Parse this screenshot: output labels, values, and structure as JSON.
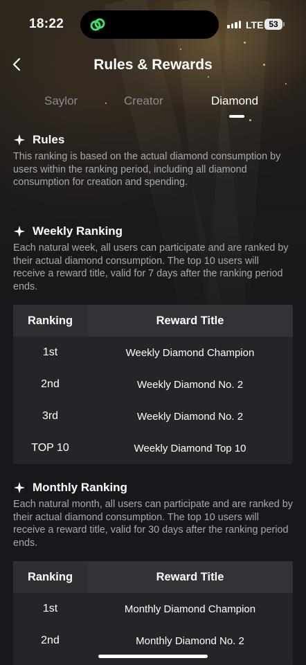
{
  "status_bar": {
    "time": "18:22",
    "network": "LTE",
    "battery": "53"
  },
  "header": {
    "title": "Rules & Rewards"
  },
  "tabs": [
    {
      "label": "Saylor",
      "active": false
    },
    {
      "label": "Creator",
      "active": false
    },
    {
      "label": "Diamond",
      "active": true
    }
  ],
  "rules": {
    "heading": "Rules",
    "body": "This ranking is based on the actual diamond consumption by users within the ranking period, including all diamond consumption for creation and spending."
  },
  "weekly": {
    "heading": "Weekly Ranking",
    "body": "Each natural week, all users can participate and are ranked by their actual diamond consumption. The top 10 users will receive a reward title, valid for 7 days after the ranking period ends.",
    "table": {
      "headers": [
        "Ranking",
        "Reward Title"
      ],
      "rows": [
        {
          "rank": "1st",
          "title": "Weekly Diamond Champion"
        },
        {
          "rank": "2nd",
          "title": "Weekly Diamond No. 2"
        },
        {
          "rank": "3rd",
          "title": "Weekly Diamond No. 2"
        },
        {
          "rank": "TOP 10",
          "title": "Weekly Diamond Top 10"
        }
      ]
    }
  },
  "monthly": {
    "heading": "Monthly Ranking",
    "body": "Each natural month, all users can participate and are ranked by their actual diamond consumption. The top 10 users will receive a reward title, valid for 30 days after the ranking period ends.",
    "table": {
      "headers": [
        "Ranking",
        "Reward Title"
      ],
      "rows": [
        {
          "rank": "1st",
          "title": "Monthly Diamond Champion"
        },
        {
          "rank": "2nd",
          "title": "Monthly Diamond No. 2"
        }
      ]
    }
  },
  "colors": {
    "background": "#17171c",
    "table": "#252529",
    "table_header": "#323237",
    "muted_text": "#a9a9ad",
    "island_icon": "#3ee06a"
  },
  "icons": [
    "link-app-icon",
    "back-chevron-icon",
    "sparkle-star-icon"
  ]
}
